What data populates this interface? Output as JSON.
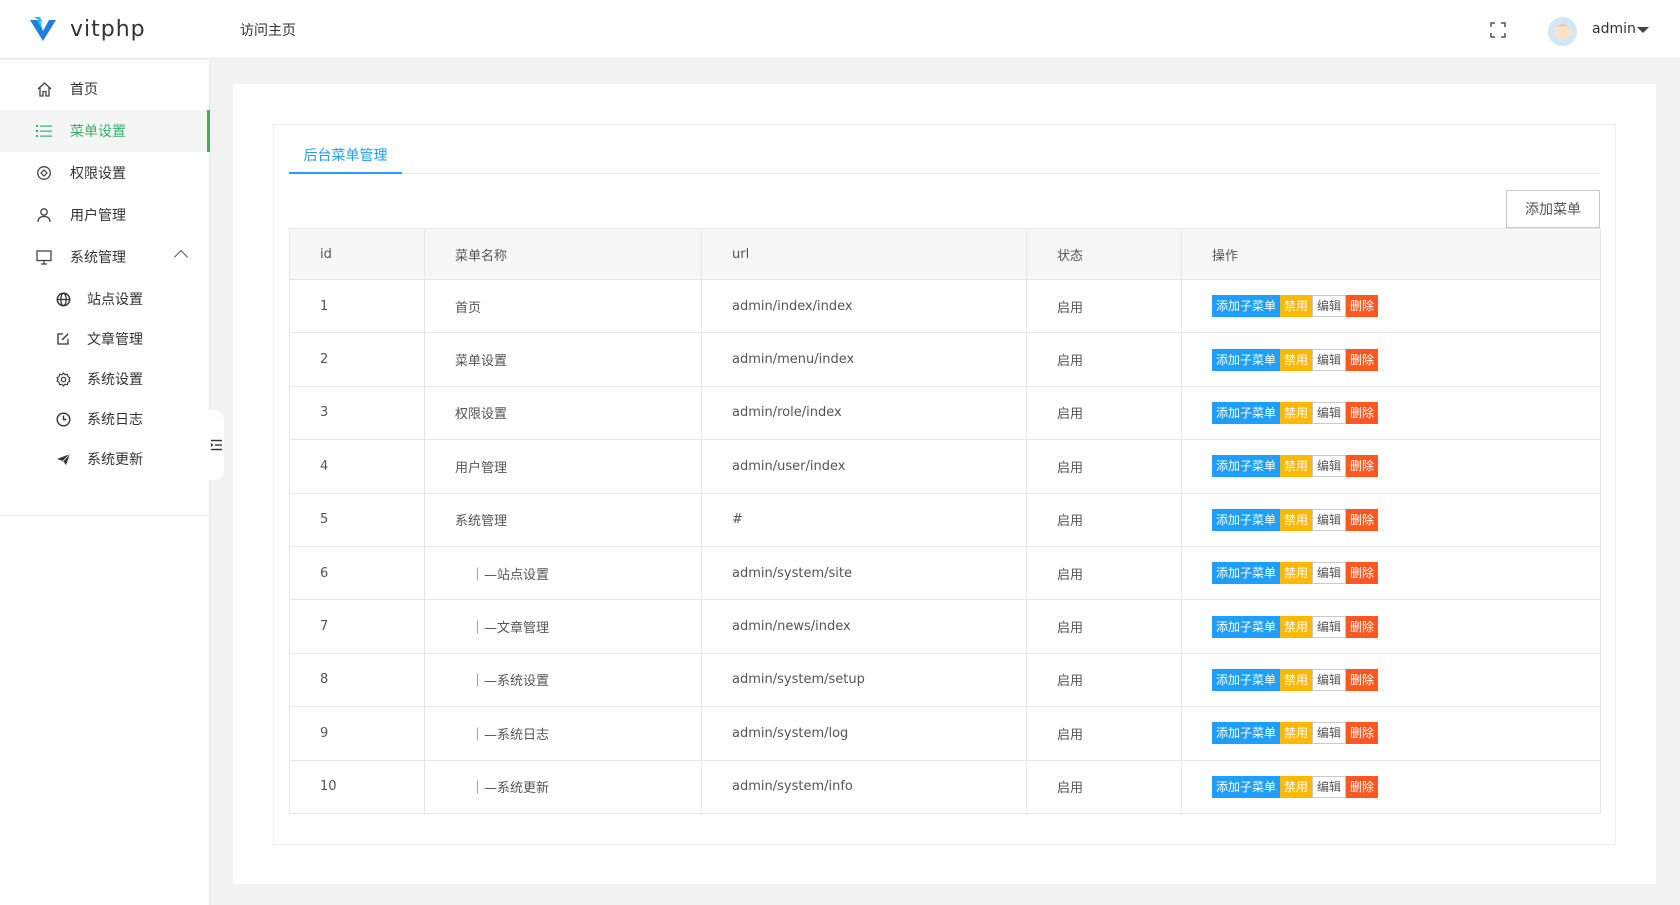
{
  "header": {
    "logo_text": "vitphp",
    "visit_home": "访问主页",
    "user_name": "admin"
  },
  "sidebar": {
    "items": [
      {
        "label": "首页",
        "icon": "home-icon"
      },
      {
        "label": "菜单设置",
        "icon": "list-icon"
      },
      {
        "label": "权限设置",
        "icon": "shield-icon"
      },
      {
        "label": "用户管理",
        "icon": "user-icon"
      },
      {
        "label": "系统管理",
        "icon": "monitor-icon"
      }
    ],
    "sub_items": [
      {
        "label": "站点设置",
        "icon": "globe-icon"
      },
      {
        "label": "文章管理",
        "icon": "edit-icon"
      },
      {
        "label": "系统设置",
        "icon": "gear-icon"
      },
      {
        "label": "系统日志",
        "icon": "clock-icon"
      },
      {
        "label": "系统更新",
        "icon": "send-icon"
      }
    ]
  },
  "main": {
    "tab_label": "后台菜单管理",
    "add_menu_label": "添加菜单",
    "columns": [
      "id",
      "菜单名称",
      "url",
      "状态",
      "操作"
    ],
    "actions": {
      "add_child": "添加子菜单",
      "disable": "禁用",
      "edit": "编辑",
      "delete": "删除"
    },
    "rows": [
      {
        "id": "1",
        "name": "首页",
        "url": "admin/index/index",
        "status": "启用"
      },
      {
        "id": "2",
        "name": "菜单设置",
        "url": "admin/menu/index",
        "status": "启用"
      },
      {
        "id": "3",
        "name": "权限设置",
        "url": "admin/role/index",
        "status": "启用"
      },
      {
        "id": "4",
        "name": "用户管理",
        "url": "admin/user/index",
        "status": "启用"
      },
      {
        "id": "5",
        "name": "系统管理",
        "url": "#",
        "status": "启用"
      },
      {
        "id": "6",
        "name": "｜—站点设置",
        "url": "admin/system/site",
        "status": "启用"
      },
      {
        "id": "7",
        "name": "｜—文章管理",
        "url": "admin/news/index",
        "status": "启用"
      },
      {
        "id": "8",
        "name": "｜—系统设置",
        "url": "admin/system/setup",
        "status": "启用"
      },
      {
        "id": "9",
        "name": "｜—系统日志",
        "url": "admin/system/log",
        "status": "启用"
      },
      {
        "id": "10",
        "name": "｜—系统更新",
        "url": "admin/system/info",
        "status": "启用"
      }
    ]
  },
  "colors": {
    "accent_green": "#36b368",
    "accent_blue": "#1e9fff",
    "warn_yellow": "#ffb800",
    "danger_orange": "#ff5722"
  }
}
